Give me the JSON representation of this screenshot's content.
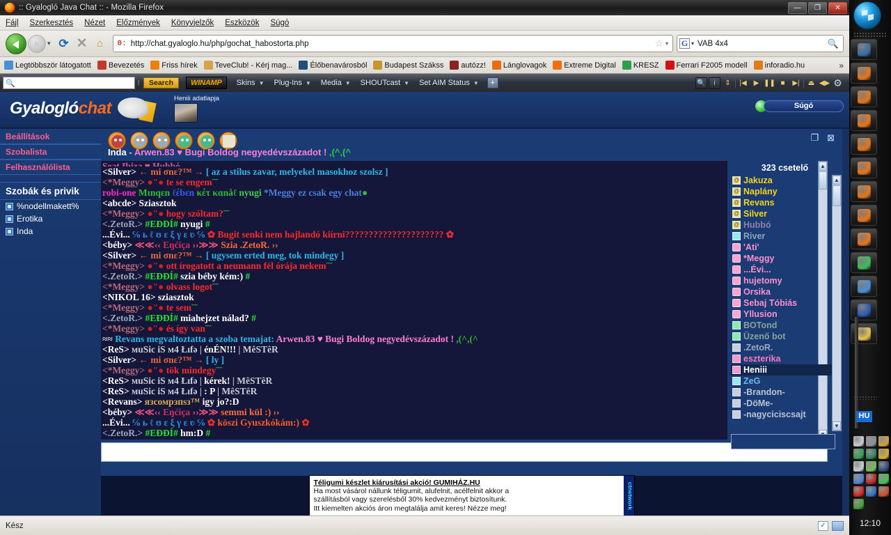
{
  "browser": {
    "title": ":: Gyalogló Java Chat :: - Mozilla Firefox",
    "menu": [
      "Fájl",
      "Szerkesztés",
      "Nézet",
      "Előzmények",
      "Könyvjelzők",
      "Eszközök",
      "Súgó"
    ],
    "url": "http://chat.gyaloglo.hu/php/gochat_habostorta.php",
    "url_favicon": "0:",
    "search_engine": "G",
    "search_value": "VAB 4x4",
    "window_buttons": {
      "minimize": "—",
      "maximize": "❐",
      "close": "✕"
    },
    "bookmarks": [
      {
        "label": "Legtöbbször látogatott",
        "color": "#4a8fd4"
      },
      {
        "label": "Bevezetés",
        "color": "#c0392b"
      },
      {
        "label": "Friss hírek",
        "color": "#e8820c"
      },
      {
        "label": "TeveClub! - Kérj mag...",
        "color": "#d6a24a"
      },
      {
        "label": "Élőbenavárosból",
        "color": "#1f4e79"
      },
      {
        "label": "Budapest Szákss",
        "color": "#c8962a"
      },
      {
        "label": "autózz!",
        "color": "#8a2222"
      },
      {
        "label": "Lánglovagok",
        "color": "#e86d0c"
      },
      {
        "label": "Extreme Digital",
        "color": "#f07010"
      },
      {
        "label": "KRESZ",
        "color": "#2f9e4f"
      },
      {
        "label": "Ferrari F2005 modell",
        "color": "#d21212"
      },
      {
        "label": "inforadio.hu",
        "color": "#e07a1a"
      }
    ],
    "bookmarks_more": "»",
    "status": "Kész"
  },
  "winamp": {
    "search_placeholder": "",
    "search_button": "Search",
    "logo": "WINAMP",
    "menus": [
      "Skins",
      "Plug-Ins",
      "Media",
      "SHOUTcast",
      "Set AIM Status"
    ],
    "plus_label": "+",
    "controls": [
      "search-icon",
      "info-icon",
      "updown-icon",
      "prev-icon",
      "play-icon",
      "pause-icon",
      "stop-icon",
      "next-icon",
      "eject-icon",
      "volume-icon",
      "gear-icon"
    ]
  },
  "site": {
    "logo_white": "Gyalogló",
    "logo_orange": "chat",
    "profile_label": "Heniii adatlapja",
    "help_button": "Súgó"
  },
  "left_panel": {
    "nav": [
      "Beállítások",
      "Szobalista",
      "Felhasználólista"
    ],
    "section_title": "Szobák és privik",
    "rooms": [
      "%nodellmakett%",
      "Erotika",
      "Inda"
    ]
  },
  "chat_window": {
    "toolbar_icons": [
      "question-smiley-icon",
      "bomb-smiley-icon",
      "surprised-smiley-icon",
      "people-smiley-icon",
      "info-smiley-icon",
      "notepad-icon"
    ],
    "restore_icon": "❐",
    "close_icon": "⊠",
    "room_name": "Inda",
    "separator": "-",
    "topic": "Arwen.83 ♥ Bugi Boldog  negyedévszázadot !",
    "topic_tail": ",(^,(^",
    "message_input_value": "",
    "scrollbar_up": "▲",
    "scrollbar_down": "▼"
  },
  "chat_lines": [
    {
      "id": 0,
      "cut": true,
      "parts": [
        {
          "t": "Seat Ibiza ♥ Hubbó",
          "c": "#d05a9a"
        }
      ]
    },
    {
      "id": 1,
      "parts": [
        {
          "t": "<Silver> ",
          "c": "#ffffff"
        },
        {
          "t": "← mi σnε?™ → ",
          "c": "#e86a3a"
        },
        {
          "t": "[ az a stilus zavar, melyekel masokhoz szolsz ]",
          "c": "#2fb7e8"
        }
      ]
    },
    {
      "id": 2,
      "parts": [
        {
          "t": "<*Meggy> ",
          "c": "#b86a7a"
        },
        {
          "t": "  ●\"●",
          "c": "#d02020"
        },
        {
          "t": "       te se engem",
          "c": "#ff2a2a"
        },
        {
          "t": "¨¨",
          "c": "#3fbf3f"
        }
      ]
    },
    {
      "id": 3,
      "parts": [
        {
          "t": "robi-one ",
          "c": "#ff2fc0"
        },
        {
          "t": "Mιnqεn ",
          "c": "#2fc02f"
        },
        {
          "t": "ℓέbεn ",
          "c": "#3a5ef0"
        },
        {
          "t": "κέτ κɑnåℓ",
          "c": "#2fc02f"
        },
        {
          "t": "     nyugi ",
          "c": "#3fd04f"
        },
        {
          "t": "*Meggy ez csak egy chat",
          "c": "#4a7fe0"
        },
        {
          "t": "●",
          "c": "#2fc02f"
        }
      ]
    },
    {
      "id": 4,
      "parts": [
        {
          "t": "<abcde> Sziasztok",
          "c": "#ffffff"
        }
      ]
    },
    {
      "id": 5,
      "parts": [
        {
          "t": "<*Meggy> ",
          "c": "#b86a7a"
        },
        {
          "t": "  ●\"●",
          "c": "#d02020"
        },
        {
          "t": "       hogy szóltam?",
          "c": "#ff2a2a"
        },
        {
          "t": "¨¨",
          "c": "#3fbf3f"
        }
      ]
    },
    {
      "id": 6,
      "parts": [
        {
          "t": "<.ZetoR.> ",
          "c": "#9aa8bb"
        },
        {
          "t": "#EÐÐÍ# ",
          "c": "#2fe02f"
        },
        {
          "t": "nyugi ",
          "c": "#ffffff"
        },
        {
          "t": "#",
          "c": "#2fe02f"
        }
      ]
    },
    {
      "id": 7,
      "parts": [
        {
          "t": "...Évi... ",
          "c": "#ffffff"
        },
        {
          "t": "℅ ь ℓ ʊ ε ξ γ ε ʋ ℅ ",
          "c": "#2f8fe0"
        },
        {
          "t": "✿ ",
          "c": "#ff2a2a"
        },
        {
          "t": " Bugit senki nem hajlandó kiírni?????????????????????",
          "c": "#ff2a2a"
        },
        {
          "t": "  ✿",
          "c": "#ff2a2a"
        }
      ]
    },
    {
      "id": 8,
      "parts": [
        {
          "t": "<béby> ",
          "c": "#ffffff"
        },
        {
          "t": "≪≪‹‹ ",
          "c": "#e8507a"
        },
        {
          "t": "Eŋćiça ",
          "c": "#d02f5f"
        },
        {
          "t": "››≫≫ ",
          "c": "#e8507a"
        },
        {
          "t": " Szia .ZetoR.  ››",
          "c": "#ff6a3a"
        }
      ]
    },
    {
      "id": 9,
      "parts": [
        {
          "t": "<Silver> ",
          "c": "#ffffff"
        },
        {
          "t": "← mi σnε?™ → ",
          "c": "#e86a3a"
        },
        {
          "t": "[ ugysem erted meg, tok mindegy ]",
          "c": "#2fb7e8"
        }
      ]
    },
    {
      "id": 10,
      "parts": [
        {
          "t": "<*Meggy> ",
          "c": "#b86a7a"
        },
        {
          "t": "  ●\"●",
          "c": "#d02020"
        },
        {
          "t": "       ott írogatott a neumann fél órája nekem",
          "c": "#ff2a2a"
        },
        {
          "t": "¨¨",
          "c": "#3fbf3f"
        }
      ]
    },
    {
      "id": 11,
      "parts": [
        {
          "t": "<.ZetoR.> ",
          "c": "#9aa8bb"
        },
        {
          "t": "#EÐÐÍ# ",
          "c": "#2fe02f"
        },
        {
          "t": "szia béby kém:) ",
          "c": "#ffffff"
        },
        {
          "t": "#",
          "c": "#2fe02f"
        }
      ]
    },
    {
      "id": 12,
      "parts": [
        {
          "t": "<*Meggy> ",
          "c": "#b86a7a"
        },
        {
          "t": "  ●\"●",
          "c": "#d02020"
        },
        {
          "t": "       olvass logot",
          "c": "#ff2a2a"
        },
        {
          "t": "¨¨",
          "c": "#3fbf3f"
        }
      ]
    },
    {
      "id": 13,
      "parts": [
        {
          "t": "<NIKOL 16> sziasztok",
          "c": "#ffffff"
        }
      ]
    },
    {
      "id": 14,
      "parts": [
        {
          "t": "<*Meggy> ",
          "c": "#b86a7a"
        },
        {
          "t": "  ●\"●",
          "c": "#d02020"
        },
        {
          "t": "       te sem",
          "c": "#ff2a2a"
        },
        {
          "t": "¨¨",
          "c": "#3fbf3f"
        }
      ]
    },
    {
      "id": 15,
      "parts": [
        {
          "t": "<.ZetoR.> ",
          "c": "#9aa8bb"
        },
        {
          "t": "#EÐÐÍ# ",
          "c": "#2fe02f"
        },
        {
          "t": "miahejzet nálad? ",
          "c": "#ffffff"
        },
        {
          "t": "#",
          "c": "#2fe02f"
        }
      ]
    },
    {
      "id": 16,
      "parts": [
        {
          "t": "<*Meggy> ",
          "c": "#b86a7a"
        },
        {
          "t": "  ●\"●",
          "c": "#d02020"
        },
        {
          "t": "       és így van",
          "c": "#ff2a2a"
        },
        {
          "t": "¨¨",
          "c": "#3fbf3f"
        }
      ]
    },
    {
      "id": 17,
      "parts": [
        {
          "t": "≈≈ ",
          "c": "#d8d8d8"
        },
        {
          "t": "Revans megvaltoztatta a szoba temajat:  ",
          "c": "#2fb7e8"
        },
        {
          "t": "Arwen.83 ♥ Bugi Boldog  negyedévszázadot !",
          "c": "#ff7fd4"
        },
        {
          "t": " ,(^,(^",
          "c": "#2fc02f"
        }
      ]
    },
    {
      "id": 18,
      "parts": [
        {
          "t": "<ReS> ",
          "c": "#ffffff"
        },
        {
          "t": " мuSic iS м4 Łıfә  |    ",
          "c": "#c8ccd4"
        },
        {
          "t": "énÉN!!!",
          "c": "#ffffff"
        },
        {
          "t": "    |    MêSTêR",
          "c": "#c8ccd4"
        }
      ]
    },
    {
      "id": 19,
      "parts": [
        {
          "t": "<Silver> ",
          "c": "#ffffff"
        },
        {
          "t": "← mi σnε?™ → ",
          "c": "#e86a3a"
        },
        {
          "t": "[ ly ]",
          "c": "#2fb7e8"
        }
      ]
    },
    {
      "id": 20,
      "parts": [
        {
          "t": "<*Meggy> ",
          "c": "#b86a7a"
        },
        {
          "t": "  ●\"●",
          "c": "#d02020"
        },
        {
          "t": "       tök mindegy",
          "c": "#ff2a2a"
        },
        {
          "t": "¨¨",
          "c": "#3fbf3f"
        }
      ]
    },
    {
      "id": 21,
      "parts": [
        {
          "t": "<ReS> ",
          "c": "#ffffff"
        },
        {
          "t": " мuSic iS м4 Łıfә  |    ",
          "c": "#c8ccd4"
        },
        {
          "t": "kérek!",
          "c": "#ffffff"
        },
        {
          "t": "    |    MêSTêR",
          "c": "#c8ccd4"
        }
      ]
    },
    {
      "id": 22,
      "parts": [
        {
          "t": "<ReS> ",
          "c": "#ffffff"
        },
        {
          "t": " мuSic iS м4 Łıfә  |    ",
          "c": "#c8ccd4"
        },
        {
          "t": ": P",
          "c": "#ffffff"
        },
        {
          "t": "    |    MêSTêR",
          "c": "#c8ccd4"
        }
      ]
    },
    {
      "id": 23,
      "parts": [
        {
          "t": "<Revans> ",
          "c": "#ffffff"
        },
        {
          "t": "  язcомрзпsз™",
          "c": "#d8a84a"
        },
        {
          "t": "     igy jo?:D",
          "c": "#ffffff"
        }
      ]
    },
    {
      "id": 24,
      "parts": [
        {
          "t": "<béby> ",
          "c": "#ffffff"
        },
        {
          "t": "≪≪‹‹ ",
          "c": "#e8507a"
        },
        {
          "t": "Eŋćiça ",
          "c": "#d02f5f"
        },
        {
          "t": "››≫≫ ",
          "c": "#e8507a"
        },
        {
          "t": " semmi kül :)  ››",
          "c": "#ff6a3a"
        }
      ]
    },
    {
      "id": 25,
      "parts": [
        {
          "t": "...Évi... ",
          "c": "#ffffff"
        },
        {
          "t": "℅ ь ℓ ʊ ε ξ γ ε ʋ ℅ ",
          "c": "#2f8fe0"
        },
        {
          "t": "✿ ",
          "c": "#ff2a2a"
        },
        {
          "t": " köszi Gyuszkókám:)",
          "c": "#ff5a2a"
        },
        {
          "t": "  ✿",
          "c": "#ff2a2a"
        }
      ]
    },
    {
      "id": 26,
      "parts": [
        {
          "t": "<.ZetoR.> ",
          "c": "#9aa8bb"
        },
        {
          "t": "#EÐÐÍ# ",
          "c": "#2fe02f"
        },
        {
          "t": "hm:D ",
          "c": "#ffffff"
        },
        {
          "t": "#",
          "c": "#2fe02f"
        }
      ]
    }
  ],
  "user_panel": {
    "count_label": "323 csetelő",
    "search_value": "",
    "users": [
      {
        "name": "Jakuza",
        "color": "#f5d318",
        "badge": "at"
      },
      {
        "name": "Naplány",
        "color": "#f5d318",
        "badge": "at"
      },
      {
        "name": "Revans",
        "color": "#f5d318",
        "badge": "at"
      },
      {
        "name": "Silver",
        "color": "#f5d318",
        "badge": "at"
      },
      {
        "name": "Hubbó",
        "color": "#8e7fa8",
        "badge": "at"
      },
      {
        "name": "River",
        "color": "#8fa4bb",
        "badge": "cy"
      },
      {
        "name": "'Ati'",
        "color": "#ff8fc8",
        "badge": "hr"
      },
      {
        "name": "*Meggy",
        "color": "#ff8fc8",
        "badge": "hr"
      },
      {
        "name": "...Évi...",
        "color": "#ff8fc8",
        "badge": "hr"
      },
      {
        "name": "hujetomy",
        "color": "#ff8fc8",
        "badge": "hr"
      },
      {
        "name": "Orsika",
        "color": "#ff8fc8",
        "badge": "hr"
      },
      {
        "name": "Sebaj Tóbiás",
        "color": "#ff8fc8",
        "badge": "hr"
      },
      {
        "name": "Yllusion",
        "color": "#ff8fc8",
        "badge": "hr"
      },
      {
        "name": "BOTond",
        "color": "#88a398",
        "badge": "bt"
      },
      {
        "name": "Üzenő bot",
        "color": "#88a398",
        "badge": "bt"
      },
      {
        "name": ".ZetoR.",
        "color": "#9aa8bb",
        "badge": "pc"
      },
      {
        "name": "eszterika",
        "color": "#ff7ab8",
        "badge": "pr"
      },
      {
        "name": "Heniii",
        "color": "#ffffff",
        "badge": "pr",
        "selected": true
      },
      {
        "name": "ZeG",
        "color": "#6fb8e8",
        "badge": "cy"
      },
      {
        "name": "-Brandon-",
        "color": "#b8c4d4",
        "badge": "pc"
      },
      {
        "name": "-DöMe-",
        "color": "#b8c4d4",
        "badge": "pc"
      },
      {
        "name": "-nagyciciscsajt",
        "color": "#b8c4d4",
        "badge": "pc"
      }
    ]
  },
  "ad": {
    "headline": "Téligumi készlet kiárusítási akció! GUMIHÁZ.HU",
    "line1": "Ha most vásárol nállunk téligumit, alufelnit, acélfelnit akkor a",
    "line2": "szállításból vagy szerelésből 30% kedvezményt biztosítunk.",
    "line3": "Itt kiemelten akciós áron megtalálja amit keres! Nézze meg!",
    "side_label": "ctnetwork"
  },
  "taskbar": {
    "language": "HU",
    "clock": "12:10",
    "items": [
      {
        "name": "window-item",
        "color": "#3a6ea5"
      },
      {
        "name": "firefox-item",
        "color": "#e8761a"
      },
      {
        "name": "firefox-item",
        "color": "#e8761a"
      },
      {
        "name": "firefox-item",
        "color": "#e8761a"
      },
      {
        "name": "firefox-item",
        "color": "#e8761a"
      },
      {
        "name": "firefox-item",
        "color": "#e8761a"
      },
      {
        "name": "firefox-item",
        "color": "#e8761a"
      },
      {
        "name": "firefox-item",
        "color": "#e8761a"
      },
      {
        "name": "firefox-item",
        "color": "#e8761a"
      },
      {
        "name": "paint-item",
        "color": "#3bbf5a"
      },
      {
        "name": "picture-item",
        "color": "#4a8fd4"
      },
      {
        "name": "word-item",
        "color": "#2a5bb5"
      },
      {
        "name": "notepad-item",
        "color": "#e8c54a"
      }
    ],
    "tray": [
      {
        "name": "printer-tray-icon",
        "color": "#c8cdd6"
      },
      {
        "name": "speaker-tray-icon",
        "color": "#8a8f98"
      },
      {
        "name": "java-tray-icon",
        "color": "#d8a030"
      },
      {
        "name": "power-tray-icon",
        "color": "#2f9e4f"
      },
      {
        "name": "headset-tray-icon",
        "color": "#2f7f5f"
      },
      {
        "name": "colors-tray-icon",
        "color": "#d8b020"
      },
      {
        "name": "disc-tray-icon",
        "color": "#c8ccd4"
      },
      {
        "name": "msn-tray-icon",
        "color": "#6fbf4f"
      },
      {
        "name": "network-tray-icon",
        "color": "#2a4a7a"
      },
      {
        "name": "monitor-tray-icon",
        "color": "#4a7fd0"
      },
      {
        "name": "shield-tray-icon",
        "color": "#c02020"
      },
      {
        "name": "sync-tray-icon",
        "color": "#3fbf4f"
      },
      {
        "name": "ati-tray-icon",
        "color": "#d02020"
      },
      {
        "name": "globe-tray-icon",
        "color": "#2a6fc0"
      },
      {
        "name": "spiral-tray-icon",
        "color": "#d04a2a"
      },
      {
        "name": "flash-tray-icon",
        "color": "#3fa030"
      }
    ]
  }
}
